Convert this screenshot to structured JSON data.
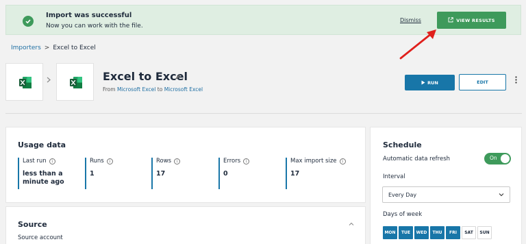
{
  "banner": {
    "title": "Import was successful",
    "message": "Now you can work with the file.",
    "dismiss_label": "Dismiss",
    "view_results_label": "VIEW RESULTS"
  },
  "breadcrumb": {
    "parent": "Importers",
    "separator": ">",
    "current": "Excel to Excel"
  },
  "importer": {
    "title": "Excel to Excel",
    "from_prefix": "From",
    "source": "Microsoft Excel",
    "to_word": "to",
    "destination": "Microsoft Excel"
  },
  "actions": {
    "run_label": "RUN",
    "edit_label": "EDIT"
  },
  "usage": {
    "heading": "Usage data",
    "stats": [
      {
        "label": "Last run",
        "value": "less than a minute ago"
      },
      {
        "label": "Runs",
        "value": "1"
      },
      {
        "label": "Rows",
        "value": "17"
      },
      {
        "label": "Errors",
        "value": "0"
      },
      {
        "label": "Max import size",
        "value": "17"
      }
    ]
  },
  "source_section": {
    "heading": "Source",
    "account_label": "Source account"
  },
  "schedule": {
    "heading": "Schedule",
    "auto_refresh_label": "Automatic data refresh",
    "toggle_label": "On",
    "interval_label": "Interval",
    "interval_value": "Every Day",
    "days_label": "Days of week",
    "days": [
      {
        "label": "MON",
        "selected": true
      },
      {
        "label": "TUE",
        "selected": true
      },
      {
        "label": "WED",
        "selected": true
      },
      {
        "label": "THU",
        "selected": true
      },
      {
        "label": "FRI",
        "selected": true
      },
      {
        "label": "SAT",
        "selected": false
      },
      {
        "label": "SUN",
        "selected": false
      }
    ]
  },
  "colors": {
    "success_green": "#3e9a5b",
    "primary_blue": "#1876a8",
    "banner_bg": "#dfeee2",
    "arrow_red": "#e0201c",
    "excel_green": "#1d6f42"
  },
  "icons": {
    "success": "check-circle-icon",
    "external_link": "external-link-icon",
    "excel": "excel-logo-icon",
    "edit": "pencil-icon",
    "play": "play-icon",
    "more": "kebab-menu-icon",
    "info": "info-icon",
    "collapse": "chevron-up-icon",
    "dropdown": "chevron-down-icon"
  }
}
